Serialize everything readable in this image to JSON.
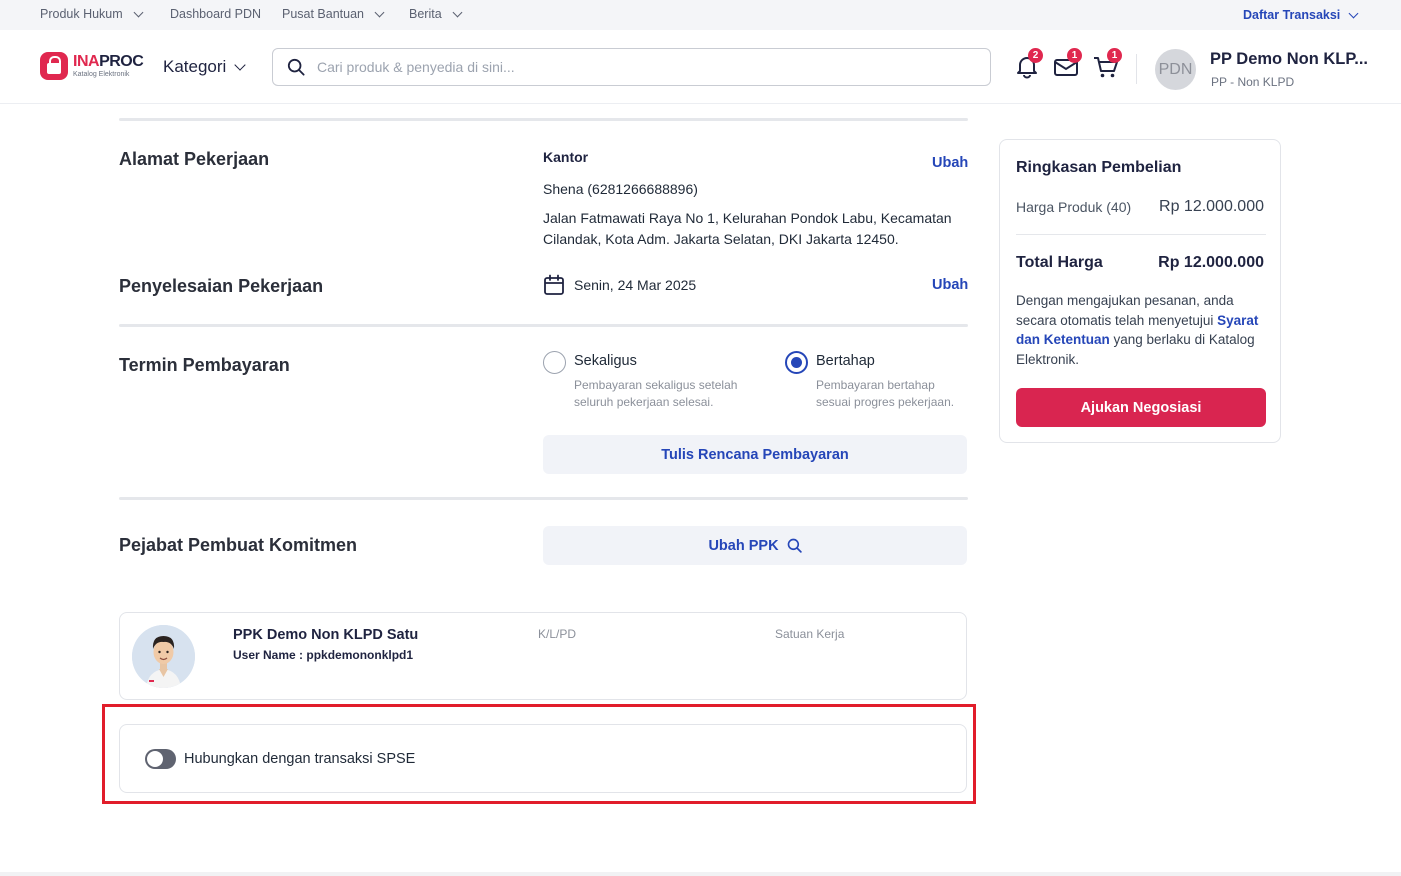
{
  "topbar": {
    "links": [
      {
        "label": "Produk Hukum",
        "has_dropdown": true
      },
      {
        "label": "Dashboard PDN",
        "has_dropdown": false
      },
      {
        "label": "Pusat Bantuan",
        "has_dropdown": true
      },
      {
        "label": "Berita",
        "has_dropdown": true
      }
    ],
    "daftar_transaksi": "Daftar Transaksi"
  },
  "header": {
    "logo": {
      "brand_red": "INA",
      "brand_dark": "PROC",
      "sub": "Katalog Elektronik"
    },
    "kategori": "Kategori",
    "search_placeholder": "Cari produk & penyedia di sini...",
    "notifications": {
      "bell": "2",
      "mail": "1",
      "cart": "1"
    },
    "user": {
      "initials": "PDN",
      "name": "PP Demo Non KLP...",
      "role": "PP - Non KLPD"
    }
  },
  "alamat": {
    "title": "Alamat Pekerjaan",
    "label": "Kantor",
    "contact": "Shena (6281266688896)",
    "address_line1": "Jalan Fatmawati Raya No 1, Kelurahan Pondok Labu, Kecamatan",
    "address_line2": "Cilandak, Kota Adm. Jakarta Selatan, DKI Jakarta 12450.",
    "edit": "Ubah"
  },
  "penyelesaian": {
    "title": "Penyelesaian Pekerjaan",
    "date": "Senin, 24 Mar 2025",
    "edit": "Ubah"
  },
  "termin": {
    "title": "Termin Pembayaran",
    "options": [
      {
        "label": "Sekaligus",
        "desc1": "Pembayaran sekaligus setelah",
        "desc2": "seluruh pekerjaan selesai.",
        "selected": false
      },
      {
        "label": "Bertahap",
        "desc1": "Pembayaran bertahap",
        "desc2": "sesuai progres pekerjaan.",
        "selected": true
      }
    ],
    "plan_button": "Tulis Rencana Pembayaran"
  },
  "ppk": {
    "title": "Pejabat Pembuat Komitmen",
    "change_button": "Ubah PPK",
    "name": "PPK Demo Non KLPD Satu",
    "username": "User Name : ppkdemononklpd1",
    "col_klpd": "K/L/PD",
    "col_satuan": "Satuan Kerja"
  },
  "spse": {
    "toggle_label": "Hubungkan dengan transaksi SPSE",
    "enabled": false
  },
  "summary": {
    "title": "Ringkasan Pembelian",
    "product_label": "Harga Produk (40)",
    "product_price": "Rp 12.000.000",
    "total_label": "Total Harga",
    "total_price": "Rp 12.000.000",
    "note_prefix": "Dengan mengajukan pesanan, anda secara otomatis telah menyetujui ",
    "note_link": "Syarat dan Ketentuan",
    "note_suffix": " yang berlaku di Katalog Elektronik.",
    "submit_button": "Ajukan Negosiasi"
  },
  "colors": {
    "brand_red": "#e0284f",
    "link_blue": "#2546b8",
    "primary_button": "#d92550",
    "highlight_border": "#e11d2a"
  }
}
